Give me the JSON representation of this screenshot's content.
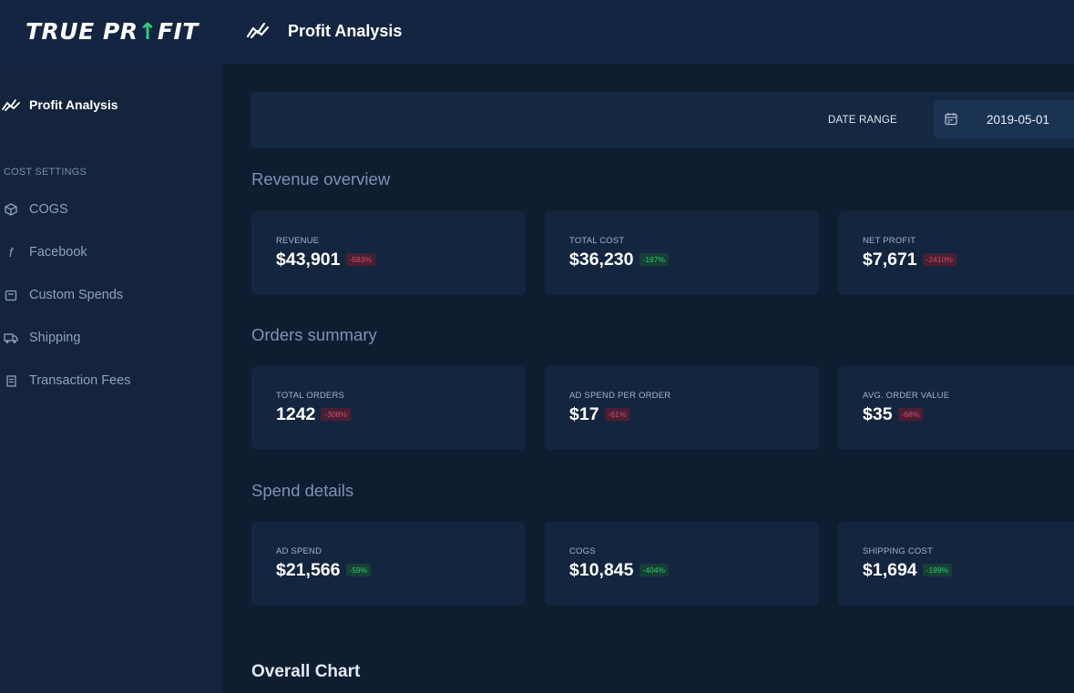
{
  "header": {
    "logo_text_left": "TRUE PR",
    "logo_text_right": "FIT",
    "logo_arrow": "⇧",
    "page_title": "Profit Analysis"
  },
  "sidebar": {
    "active_item": "Profit Analysis",
    "section_label": "COST SETTINGS",
    "items": [
      {
        "label": "COGS",
        "icon": "box-icon"
      },
      {
        "label": "Facebook",
        "icon": "facebook-icon"
      },
      {
        "label": "Custom Spends",
        "icon": "wallet-icon"
      },
      {
        "label": "Shipping",
        "icon": "truck-icon"
      },
      {
        "label": "Transaction Fees",
        "icon": "receipt-icon"
      }
    ]
  },
  "date_range": {
    "label": "DATE RANGE",
    "start": "2019-05-01",
    "separator": "-"
  },
  "sections": [
    {
      "title": "Revenue overview",
      "cards": [
        {
          "label": "REVENUE",
          "value": "$43,901",
          "change": "-583%",
          "trend": "neg"
        },
        {
          "label": "TOTAL COST",
          "value": "$36,230",
          "change": "-197%",
          "trend": "pos"
        },
        {
          "label": "NET PROFIT",
          "value": "$7,671",
          "change": "-2410%",
          "trend": "neg"
        }
      ]
    },
    {
      "title": "Orders summary",
      "cards": [
        {
          "label": "TOTAL ORDERS",
          "value": "1242",
          "change": "-308%",
          "trend": "neg"
        },
        {
          "label": "AD SPEND PER ORDER",
          "value": "$17",
          "change": "-61%",
          "trend": "neg"
        },
        {
          "label": "AVG. ORDER VALUE",
          "value": "$35",
          "change": "-68%",
          "trend": "neg"
        }
      ]
    },
    {
      "title": "Spend details",
      "cards": [
        {
          "label": "AD SPEND",
          "value": "$21,566",
          "change": "-59%",
          "trend": "pos"
        },
        {
          "label": "COGS",
          "value": "$10,845",
          "change": "-404%",
          "trend": "pos"
        },
        {
          "label": "SHIPPING COST",
          "value": "$1,694",
          "change": "-199%",
          "trend": "pos"
        }
      ]
    }
  ],
  "chart_section_title": "Overall Chart",
  "colors": {
    "background": "#0f1d31",
    "sidebar": "#13243c",
    "card": "#14263f",
    "negative": "#d64a6b",
    "positive": "#2ecc71",
    "brand_accent": "#2fd07a"
  }
}
